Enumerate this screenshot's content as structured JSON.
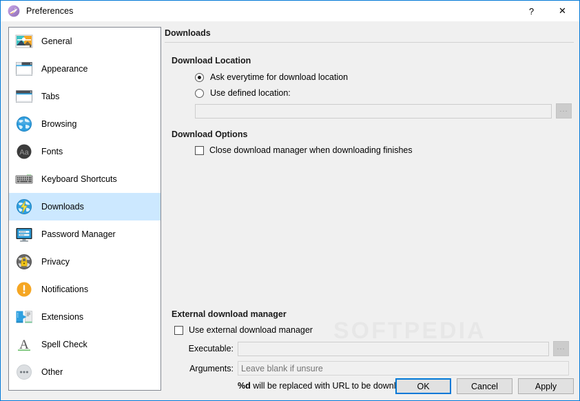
{
  "window": {
    "title": "Preferences",
    "app_icon": "falkon-logo-icon",
    "help_label": "?",
    "close_label": "✕",
    "accent_color": "#0078d7",
    "selection_color": "#cce8ff",
    "background_color": "#f0f0f0"
  },
  "sidebar": {
    "items": [
      {
        "label": "General",
        "icon": "general-picture-icon",
        "selected": false
      },
      {
        "label": "Appearance",
        "icon": "appearance-window-icon",
        "selected": false
      },
      {
        "label": "Tabs",
        "icon": "tabs-window-icon",
        "selected": false
      },
      {
        "label": "Browsing",
        "icon": "globe-icon",
        "selected": false
      },
      {
        "label": "Fonts",
        "icon": "fonts-aa-icon",
        "selected": false
      },
      {
        "label": "Keyboard Shortcuts",
        "icon": "keyboard-icon",
        "selected": false
      },
      {
        "label": "Downloads",
        "icon": "downloads-globe-icon",
        "selected": true
      },
      {
        "label": "Password Manager",
        "icon": "monitor-password-icon",
        "selected": false
      },
      {
        "label": "Privacy",
        "icon": "privacy-lock-icon",
        "selected": false
      },
      {
        "label": "Notifications",
        "icon": "notification-bang-icon",
        "selected": false
      },
      {
        "label": "Extensions",
        "icon": "extensions-puzzle-icon",
        "selected": false
      },
      {
        "label": "Spell Check",
        "icon": "spellcheck-a-icon",
        "selected": false
      },
      {
        "label": "Other",
        "icon": "other-ellipsis-icon",
        "selected": false
      }
    ]
  },
  "panel": {
    "title": "Downloads",
    "download_location": {
      "group_title": "Download Location",
      "radio_ask": {
        "label": "Ask everytime for download location",
        "checked": true
      },
      "radio_defined": {
        "label": "Use defined location:",
        "checked": false
      },
      "location_field": {
        "value": "",
        "placeholder": ""
      },
      "browse_label": "..."
    },
    "download_options": {
      "group_title": "Download Options",
      "close_manager": {
        "label": "Close download manager when downloading finishes",
        "checked": false
      }
    },
    "external_manager": {
      "group_title": "External download manager",
      "use_external": {
        "label": "Use external download manager",
        "checked": false
      },
      "executable_label": "Executable:",
      "executable_field": {
        "value": "",
        "placeholder": ""
      },
      "executable_browse_label": "...",
      "arguments_label": "Arguments:",
      "arguments_field": {
        "value": "",
        "placeholder": "Leave blank if unsure"
      },
      "hint_prefix": "%d",
      "hint_text": " will be replaced with URL to be downloaded"
    }
  },
  "footer": {
    "ok_label": "OK",
    "cancel_label": "Cancel",
    "apply_label": "Apply"
  },
  "watermark": {
    "text": "SOFTPEDIA"
  }
}
